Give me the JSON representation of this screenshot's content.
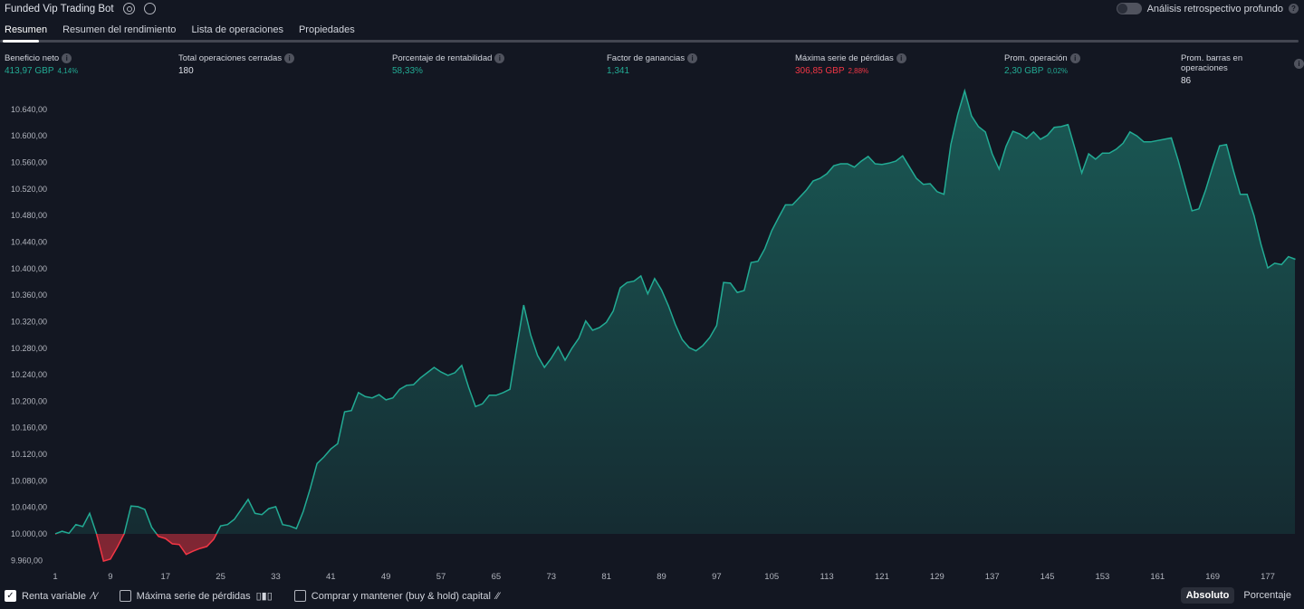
{
  "header": {
    "title": "Funded Vip Trading Bot",
    "deep_backtest_label": "Análisis retrospectivo profundo",
    "deep_backtest_on": false
  },
  "tabs": [
    {
      "label": "Resumen",
      "active": true
    },
    {
      "label": "Resumen del rendimiento"
    },
    {
      "label": "Lista de operaciones"
    },
    {
      "label": "Propiedades"
    }
  ],
  "stats": [
    {
      "label": "Beneficio neto",
      "value": "413,97 GBP",
      "pct": "4,14%",
      "color": "green"
    },
    {
      "label": "Total operaciones cerradas",
      "value": "180",
      "pct": "",
      "color": "white"
    },
    {
      "label": "Porcentaje de rentabilidad",
      "value": "58,33%",
      "pct": "",
      "color": "green"
    },
    {
      "label": "Factor de ganancias",
      "value": "1,341",
      "pct": "",
      "color": "green"
    },
    {
      "label": "Máxima serie de pérdidas",
      "value": "306,85 GBP",
      "pct": "2,88%",
      "color": "red"
    },
    {
      "label": "Prom. operación",
      "value": "2,30 GBP",
      "pct": "0,02%",
      "color": "green"
    },
    {
      "label": "Prom. barras en operaciones",
      "value": "86",
      "pct": "",
      "color": "white"
    }
  ],
  "legend": [
    {
      "label": "Renta variable",
      "checked": true,
      "icon": "equity-line-icon"
    },
    {
      "label": "Máxima serie de pérdidas",
      "checked": false,
      "icon": "drawdown-bars-icon"
    },
    {
      "label": "Comprar y mantener (buy & hold) capital",
      "checked": false,
      "icon": "buy-hold-line-icon"
    }
  ],
  "scale_toggle": {
    "options": [
      "Absoluto",
      "Porcentaje"
    ],
    "selected": "Absoluto"
  },
  "colors": {
    "background": "#131722",
    "positive": "#22ab94",
    "negative": "#f23645"
  },
  "chart_data": {
    "type": "area",
    "baseline": 10000,
    "ylim": [
      9940,
      10680
    ],
    "yticks": [
      "9.960,00",
      "10.000,00",
      "10.040,00",
      "10.080,00",
      "10.120,00",
      "10.160,00",
      "10.200,00",
      "10.240,00",
      "10.280,00",
      "10.320,00",
      "10.360,00",
      "10.400,00",
      "10.440,00",
      "10.480,00",
      "10.520,00",
      "10.560,00",
      "10.600,00",
      "10.640,00"
    ],
    "ytick_values": [
      9960,
      10000,
      10040,
      10080,
      10120,
      10160,
      10200,
      10240,
      10280,
      10320,
      10360,
      10400,
      10440,
      10480,
      10520,
      10560,
      10600,
      10640
    ],
    "xticks": [
      "1",
      "9",
      "17",
      "25",
      "33",
      "41",
      "49",
      "57",
      "65",
      "73",
      "81",
      "89",
      "97",
      "105",
      "113",
      "121",
      "129",
      "137",
      "145",
      "153",
      "161",
      "169",
      "177"
    ],
    "values": [
      10000,
      10004,
      10001,
      10014,
      10011,
      10031,
      10000,
      9959,
      9962,
      9980,
      10000,
      10042,
      10041,
      10037,
      10010,
      9996,
      9993,
      9985,
      9984,
      9969,
      9974,
      9978,
      9981,
      9992,
      10012,
      10014,
      10022,
      10037,
      10052,
      10031,
      10029,
      10038,
      10041,
      10014,
      10012,
      10008,
      10034,
      10068,
      10106,
      10116,
      10128,
      10136,
      10184,
      10186,
      10213,
      10207,
      10205,
      10210,
      10202,
      10205,
      10218,
      10224,
      10225,
      10235,
      10243,
      10251,
      10244,
      10239,
      10243,
      10254,
      10221,
      10192,
      10196,
      10209,
      10209,
      10213,
      10218,
      10282,
      10345,
      10300,
      10269,
      10251,
      10265,
      10282,
      10262,
      10280,
      10295,
      10321,
      10307,
      10311,
      10319,
      10336,
      10371,
      10379,
      10381,
      10389,
      10362,
      10385,
      10368,
      10344,
      10316,
      10293,
      10281,
      10276,
      10284,
      10296,
      10314,
      10379,
      10378,
      10364,
      10367,
      10409,
      10411,
      10430,
      10457,
      10477,
      10496,
      10496,
      10507,
      10518,
      10532,
      10536,
      10543,
      10555,
      10558,
      10558,
      10553,
      10562,
      10569,
      10558,
      10557,
      10559,
      10562,
      10570,
      10553,
      10536,
      10527,
      10528,
      10516,
      10512,
      10587,
      10632,
      10668,
      10630,
      10614,
      10606,
      10573,
      10550,
      10584,
      10607,
      10603,
      10596,
      10606,
      10595,
      10601,
      10613,
      10614,
      10617,
      10581,
      10544,
      10573,
      10565,
      10574,
      10574,
      10580,
      10589,
      10606,
      10600,
      10591,
      10591,
      10593,
      10595,
      10597,
      10563,
      10525,
      10487,
      10490,
      10519,
      10553,
      10585,
      10587,
      10548,
      10512,
      10512,
      10480,
      10437,
      10401,
      10408,
      10406,
      10418,
      10414
    ]
  }
}
